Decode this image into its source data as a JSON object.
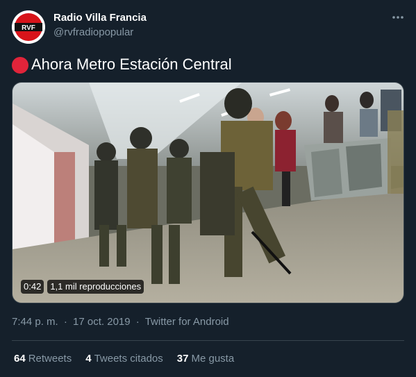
{
  "author": {
    "name": "Radio Villa Francia",
    "handle": "@rvfradiopopular",
    "avatar_text": "RVF"
  },
  "tweet": {
    "text": "Ahora Metro Estación Central",
    "emoji": "red-circle"
  },
  "video": {
    "duration": "0:42",
    "views": "1,1 mil reproducciones"
  },
  "meta": {
    "time": "7:44 p. m.",
    "sep1": "·",
    "date": "17 oct. 2019",
    "sep2": "·",
    "source": "Twitter for Android"
  },
  "stats": {
    "retweets_count": "64",
    "retweets_label": "Retweets",
    "quotes_count": "4",
    "quotes_label": "Tweets citados",
    "likes_count": "37",
    "likes_label": "Me gusta"
  },
  "colors": {
    "background": "#15202b",
    "secondary_text": "#8899a6",
    "divider": "#38444d",
    "red_dot": "#e0243a",
    "avatar_red": "#d7141a"
  },
  "icons": {
    "more": "more-dots-icon",
    "video_duration": "video-duration-badge",
    "view_count": "view-count-badge"
  }
}
